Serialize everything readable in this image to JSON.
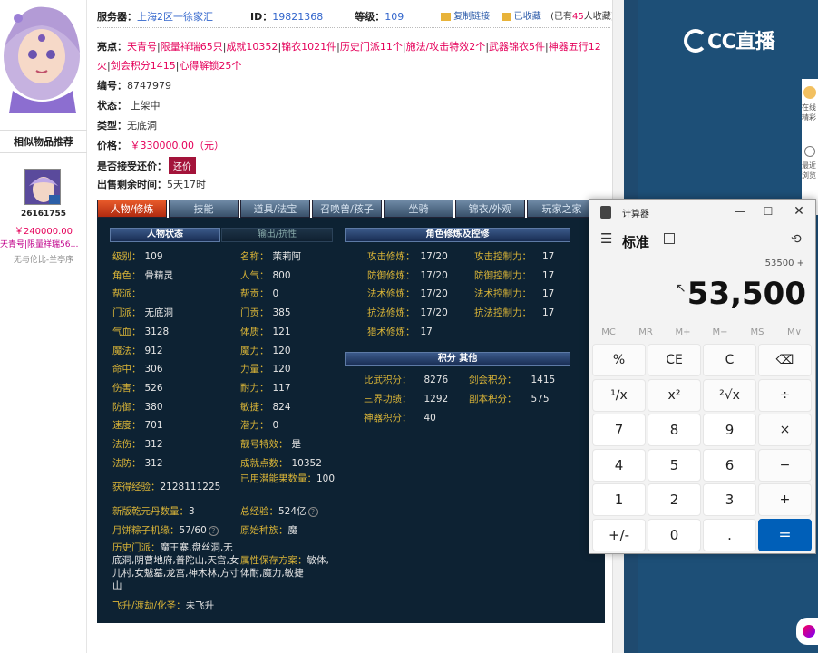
{
  "item": {
    "server_label": "服务器：",
    "server_value": "上海2区一徐家汇",
    "id_label": "ID：",
    "id_value": "19821368",
    "level_label": "等级：",
    "level_value": "109",
    "copy_link": "复制链接",
    "favorited": "已收藏",
    "fav_count_prefix": "(已有",
    "fav_count": "45",
    "fav_count_suffix": "人收藏)",
    "highlights_label": "亮点：",
    "highlights": [
      "天青号",
      "限量祥瑞65只",
      "成就10352",
      "锦衣1021件",
      "历史门派11个",
      "施法/攻击特效2个",
      "武器锦衣5件",
      "神器五行12火",
      "剑会积分1415",
      "心得解锁25个"
    ],
    "number_label": "编号：",
    "number_value": "8747979",
    "status_label": "状态：",
    "status_value": "上架中",
    "type_label": "类型：",
    "type_value": "无底洞",
    "price_label": "价格：",
    "price_value": "￥330000.00（元）",
    "bargain_label": "是否接受还价：",
    "bargain_button": "还价",
    "remaining_label": "出售剩余时间：",
    "remaining_value": "5天17时"
  },
  "similar": {
    "title": "相似物品推荐",
    "id": "26161755",
    "price": "￥240000.00",
    "tags": "天青号|限量祥瑞56…",
    "server": "无与伦比-兰亭序"
  },
  "tabs": [
    "人物/修炼",
    "技能",
    "道具/法宝",
    "召唤兽/孩子",
    "坐骑",
    "锦衣/外观",
    "玩家之家"
  ],
  "panel": {
    "sec_status": "人物状态",
    "sec_output": "输出/抗性",
    "sec_cultivation": "角色修炼及控修",
    "sec_score": "积分 其他",
    "left_stats": [
      {
        "k": "级别：",
        "v": "109"
      },
      {
        "k": "角色：",
        "v": "骨精灵"
      },
      {
        "k": "帮派：",
        "v": ""
      },
      {
        "k": "门派：",
        "v": "无底洞"
      },
      {
        "k": "气血：",
        "v": "3128"
      },
      {
        "k": "魔法：",
        "v": "912"
      },
      {
        "k": "命中：",
        "v": "306"
      },
      {
        "k": "伤害：",
        "v": "526"
      },
      {
        "k": "防御：",
        "v": "380"
      },
      {
        "k": "速度：",
        "v": "701"
      },
      {
        "k": "法伤：",
        "v": "312"
      },
      {
        "k": "法防：",
        "v": "312"
      }
    ],
    "mid_stats": [
      {
        "k": "名称：",
        "v": "茉莉阿"
      },
      {
        "k": "人气：",
        "v": "800"
      },
      {
        "k": "帮贡：",
        "v": "0"
      },
      {
        "k": "门贡：",
        "v": "385"
      },
      {
        "k": "体质：",
        "v": "121"
      },
      {
        "k": "魔力：",
        "v": "120"
      },
      {
        "k": "力量：",
        "v": "120"
      },
      {
        "k": "耐力：",
        "v": "117"
      },
      {
        "k": "敏捷：",
        "v": "824"
      },
      {
        "k": "潜力：",
        "v": "0"
      },
      {
        "k": "靓号特效：",
        "v": "是"
      },
      {
        "k": "成就点数：",
        "v": "10352"
      }
    ],
    "exp_label": "获得经验：",
    "exp_value": "2128111225",
    "used_label": "已用潜能果数量：",
    "used_value": "100",
    "qianyuan_label": "新版乾元丹数量：",
    "qianyuan_value": "3",
    "total_exp_label": "总经验：",
    "total_exp_value": "524亿",
    "moon_label": "月饼粽子机缘：",
    "moon_value": "57/60",
    "race_label": "原始种族：",
    "race_value": "魔",
    "history_label": "历史门派：",
    "history_value": "魔王寨,盘丝洞,无底洞,阴曹地府,普陀山,天宫,女儿村,女魃墓,龙宫,神木林,方寸山",
    "attr_label": "属性保存方案：",
    "attr_value": "敏体,体耐,魔力,敏捷",
    "fly_label": "飞升/渡劫/化圣：",
    "fly_value": "未飞升",
    "cult": [
      {
        "k": "攻击修炼：",
        "v": "17/20",
        "k2": "攻击控制力：",
        "v2": "17"
      },
      {
        "k": "防御修炼：",
        "v": "17/20",
        "k2": "防御控制力：",
        "v2": "17"
      },
      {
        "k": "法术修炼：",
        "v": "17/20",
        "k2": "法术控制力：",
        "v2": "17"
      },
      {
        "k": "抗法修炼：",
        "v": "17/20",
        "k2": "抗法控制力：",
        "v2": "17"
      },
      {
        "k": "猎术修炼：",
        "v": "17",
        "k2": "",
        "v2": ""
      }
    ],
    "scores": [
      {
        "k": "比武积分：",
        "v": "8276",
        "k2": "剑会积分：",
        "v2": "1415"
      },
      {
        "k": "三界功绩：",
        "v": "1292",
        "k2": "副本积分：",
        "v2": "575"
      },
      {
        "k": "神器积分：",
        "v": "40",
        "k2": "",
        "v2": ""
      }
    ]
  },
  "cc_logo": "CC直播",
  "side_text": [
    "在线",
    "精彩",
    "最近",
    "浏览"
  ],
  "calc": {
    "title": "计算器",
    "mode": "标准",
    "expression": "53500 +",
    "display": "53,500",
    "memory": [
      "MC",
      "MR",
      "M+",
      "M−",
      "MS",
      "M∨"
    ],
    "buttons": [
      "%",
      "CE",
      "C",
      "⌫",
      "¹∕x",
      "x²",
      "²√x",
      "÷",
      "7",
      "8",
      "9",
      "×",
      "4",
      "5",
      "6",
      "−",
      "1",
      "2",
      "3",
      "+",
      "+/-",
      "0",
      ".",
      "="
    ]
  },
  "colors": {
    "accent_red": "#e5005a",
    "panel_bg": "#0d2233",
    "stat_key": "#d9b437",
    "calc_equals": "#005fb8",
    "cc_blue": "#1d4f77"
  }
}
